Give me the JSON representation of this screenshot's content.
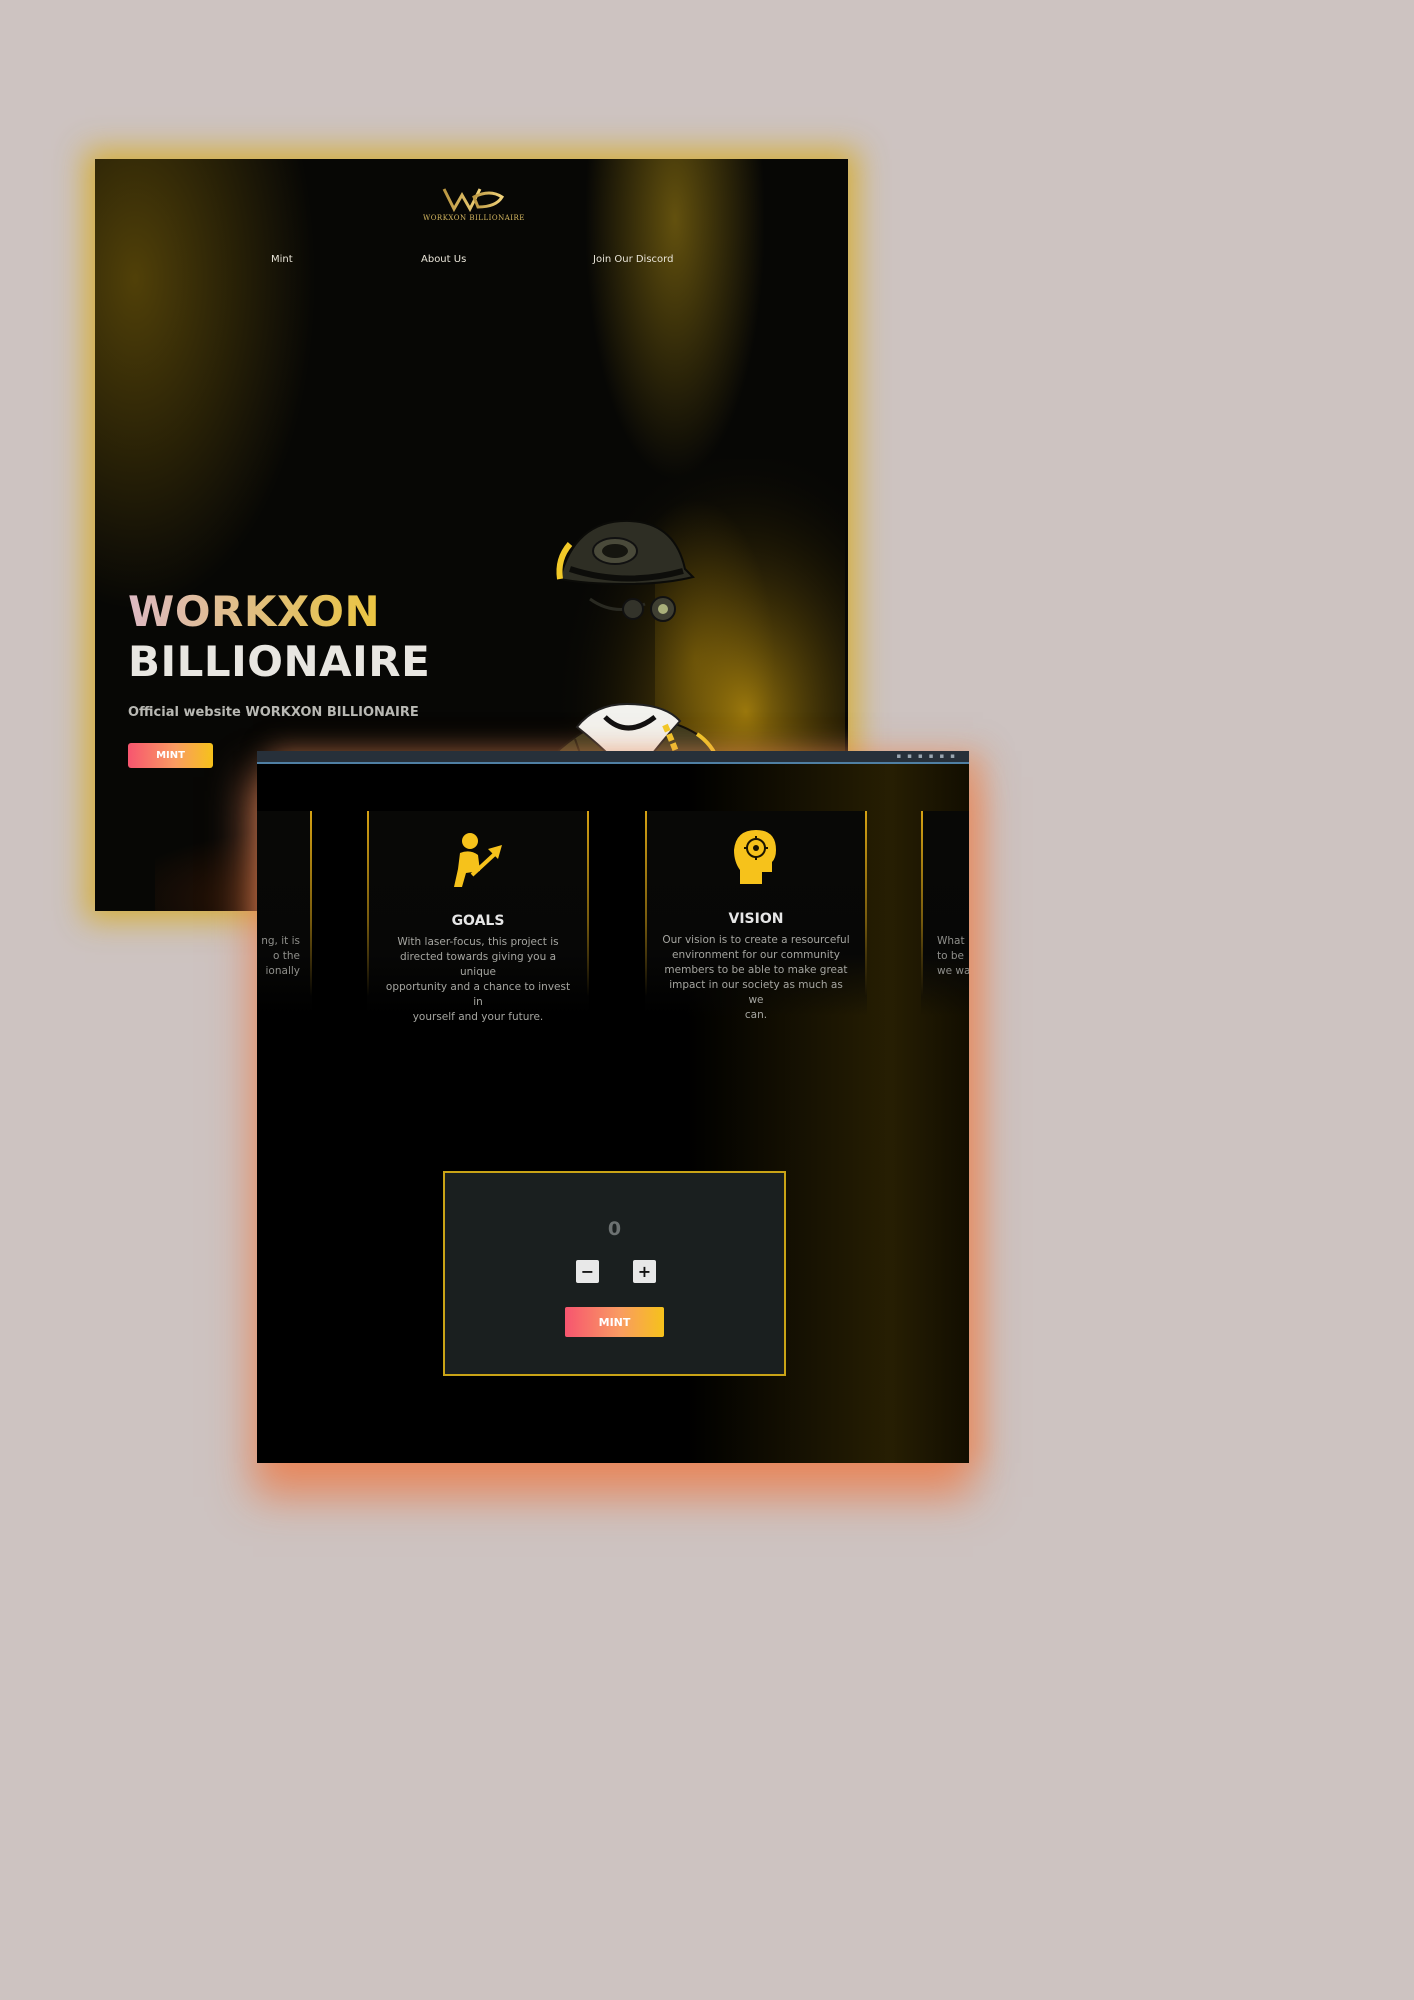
{
  "brand": {
    "logo_text": "WORKXON BILLIONAIRE",
    "accent_gold": "#f2c928",
    "gradient_pink": "#f7556f",
    "gradient_gold": "#f6c21b"
  },
  "nav": {
    "items": [
      {
        "label": "Mint"
      },
      {
        "label": "About Us"
      },
      {
        "label": "Join Our Discord"
      }
    ]
  },
  "hero": {
    "title_line1": "WORKXON",
    "title_line2": "BILLIONAIRE",
    "subtitle": "Official website WORKXON BILLIONAIRE",
    "mint_label": "MINT",
    "image": "suited-character-with-gold-chain-illustration"
  },
  "features": {
    "left_partial_lines": [
      "ng, it is",
      "o the",
      "ionally"
    ],
    "right_partial_lines": [
      "What",
      "to be",
      "we wa"
    ],
    "cards": [
      {
        "icon": "goals-person-arrow-icon",
        "title": "GOALS",
        "text_lines": [
          "With laser-focus, this project is",
          "directed towards giving you a unique",
          "opportunity and a chance to invest in",
          "yourself and your future."
        ]
      },
      {
        "icon": "vision-head-brain-icon",
        "title": "VISION",
        "text_lines": [
          "Our vision is to create a resourceful",
          "environment for our community",
          "members to be able to make great",
          "impact in our society as much as we",
          "can."
        ]
      }
    ]
  },
  "mint_panel": {
    "count": "0",
    "decrement_label": "−",
    "increment_label": "+",
    "mint_label": "MINT"
  }
}
